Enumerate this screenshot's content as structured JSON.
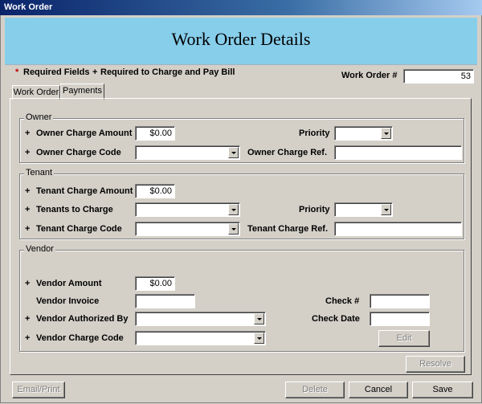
{
  "window": {
    "title": "Work Order"
  },
  "header": {
    "title": "Work Order Details"
  },
  "legend": {
    "required_marker": "*",
    "required_label": "Required Fields",
    "charge_marker": "+",
    "charge_label": "Required to Charge and Pay Bill"
  },
  "work_order": {
    "label": "Work Order #",
    "value": "53"
  },
  "tabs": [
    {
      "label": "Work Order",
      "active": false
    },
    {
      "label": "Payments",
      "active": true
    }
  ],
  "owner": {
    "group_label": "Owner",
    "charge_amount_label": "Owner Charge Amount",
    "charge_amount_value": "$0.00",
    "priority_label": "Priority",
    "charge_code_label": "Owner Charge Code",
    "charge_ref_label": "Owner Charge Ref."
  },
  "tenant": {
    "group_label": "Tenant",
    "charge_amount_label": "Tenant Charge Amount",
    "charge_amount_value": "$0.00",
    "tenants_to_charge_label": "Tenants to Charge",
    "priority_label": "Priority",
    "charge_code_label": "Tenant Charge Code",
    "charge_ref_label": "Tenant Charge Ref."
  },
  "vendor": {
    "group_label": "Vendor",
    "amount_label": "Vendor Amount",
    "amount_value": "$0.00",
    "invoice_label": "Vendor Invoice",
    "check_no_label": "Check #",
    "authorized_by_label": "Vendor Authorized By",
    "check_date_label": "Check Date",
    "charge_code_label": "Vendor Charge Code",
    "edit_label": "Edit"
  },
  "marker": "+",
  "buttons": {
    "resolve": "Resolve",
    "email_print": "Email/Print",
    "delete": "Delete",
    "cancel": "Cancel",
    "save": "Save"
  },
  "colors": {
    "header_bg": "#87ceeb",
    "required_marker": "#c00000",
    "titlebar": "#0a246a"
  }
}
